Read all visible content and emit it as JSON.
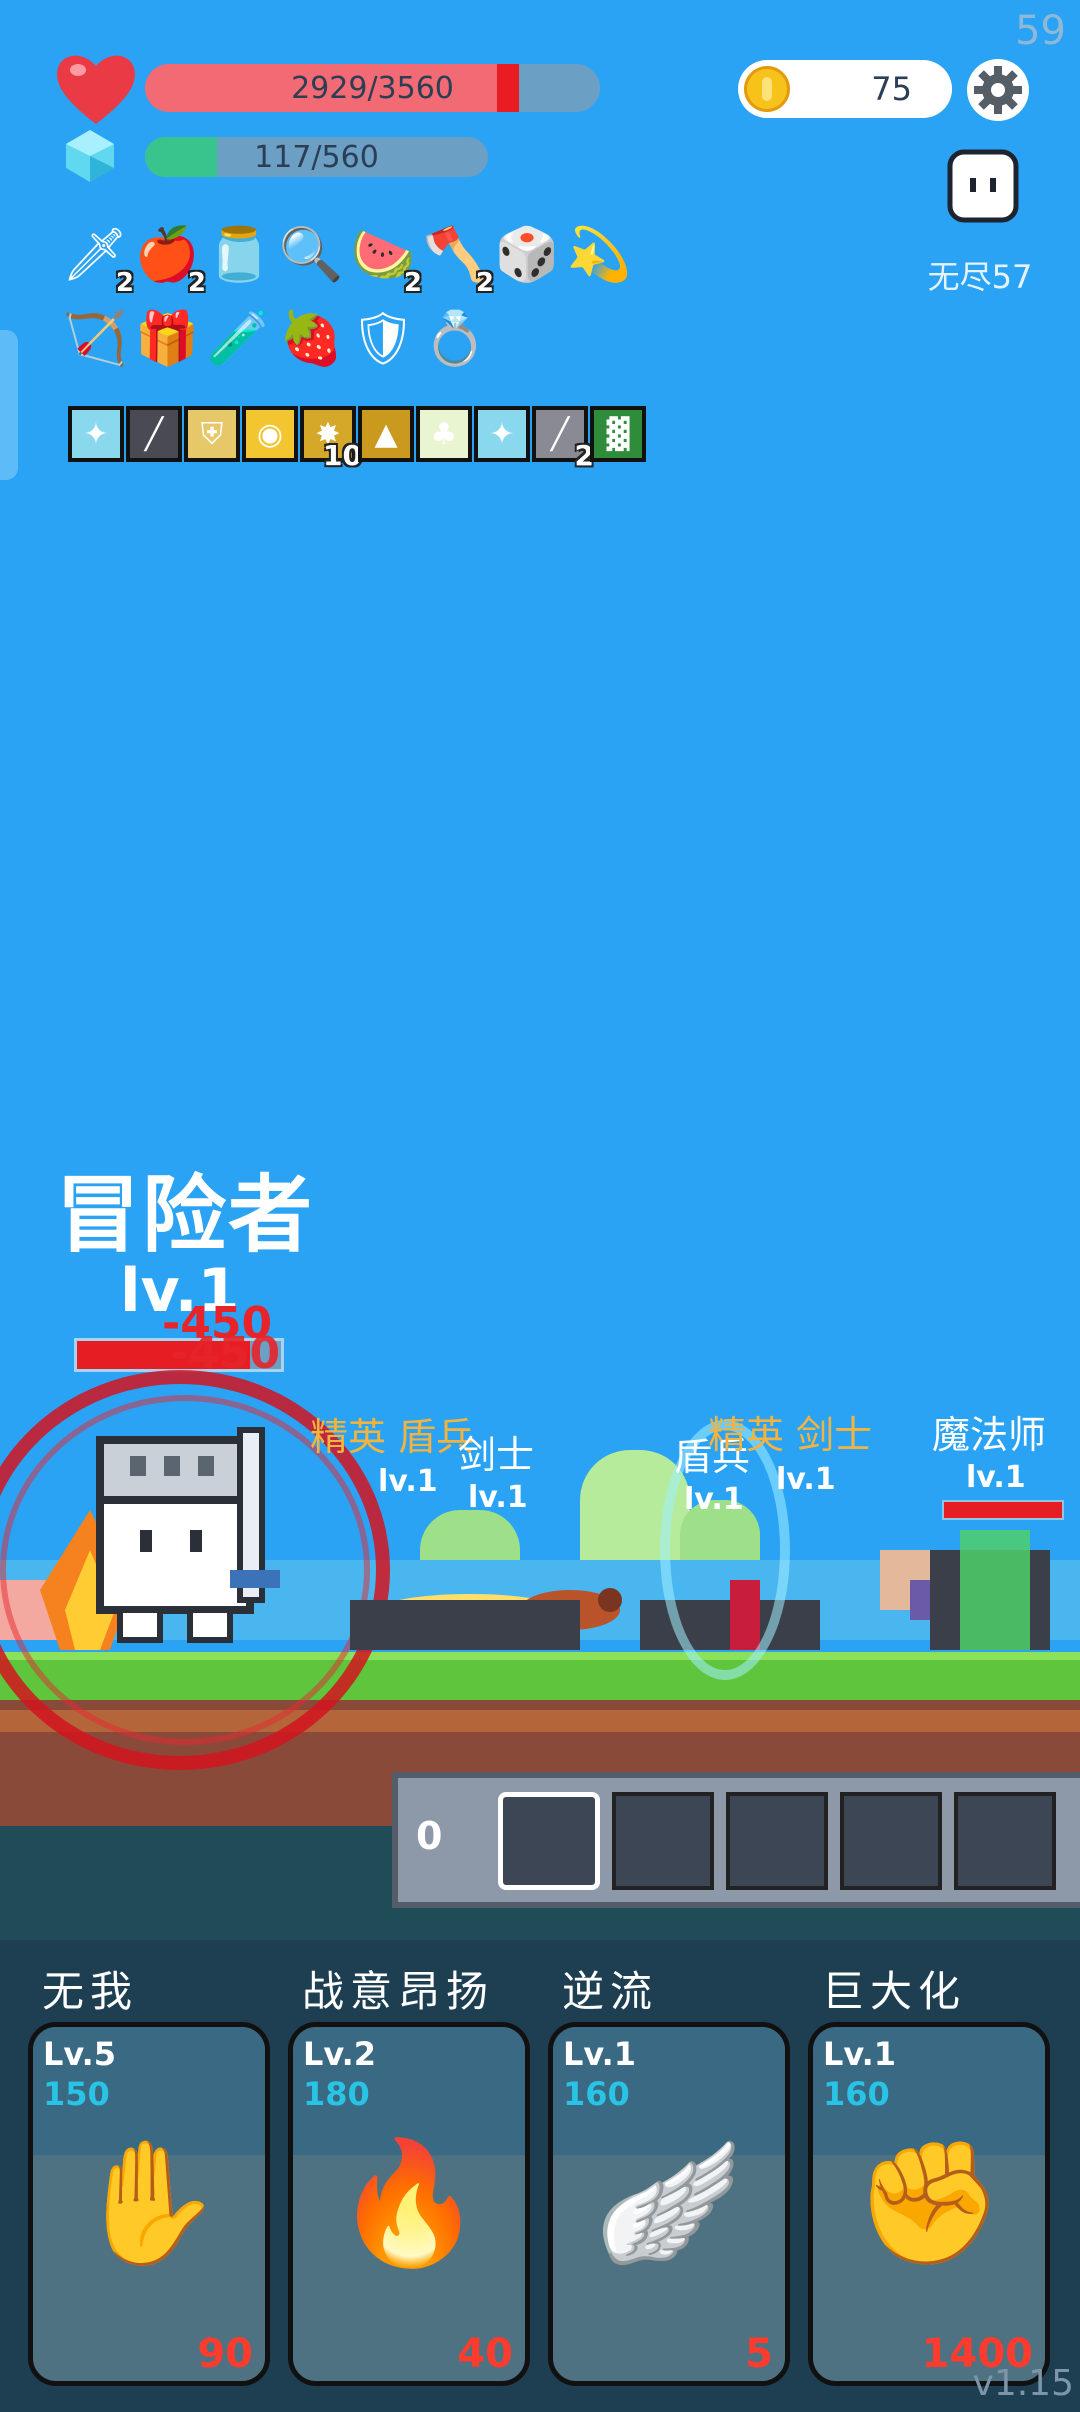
{
  "fps": "59",
  "hud": {
    "hp_text": "2929/3560",
    "hp_current": 2929,
    "hp_max": 3560,
    "mp_text": "117/560",
    "mp_current": 117,
    "mp_max": 560,
    "coins": "75",
    "mode_label": "无尽57",
    "colors": {
      "hp": "#f26a73",
      "hp_marker": "#ea1b23",
      "mp": "#39c48e",
      "coin": "#f7c21a"
    }
  },
  "items_row1": [
    {
      "icon": "sword-icon",
      "glyph": "🗡",
      "count": "2"
    },
    {
      "icon": "apple-icon",
      "glyph": "🍎",
      "count": "2"
    },
    {
      "icon": "jam-jar-icon",
      "glyph": "🫙",
      "count": ""
    },
    {
      "icon": "magnifier-icon",
      "glyph": "🔍",
      "count": ""
    },
    {
      "icon": "watermelon-icon",
      "glyph": "🍉",
      "count": "2"
    },
    {
      "icon": "axe-icon",
      "glyph": "🪓",
      "count": "2"
    },
    {
      "icon": "dice-icon",
      "glyph": "🎲",
      "count": ""
    },
    {
      "icon": "ring-orbit-icon",
      "glyph": "💫",
      "count": ""
    }
  ],
  "items_row2": [
    {
      "icon": "bow-icon",
      "glyph": "🏹",
      "count": ""
    },
    {
      "icon": "purple-chest-icon",
      "glyph": "🎁",
      "count": ""
    },
    {
      "icon": "potion-icon",
      "glyph": "🧪",
      "count": ""
    },
    {
      "icon": "strawberry-icon",
      "glyph": "🍓",
      "count": ""
    },
    {
      "icon": "shield-icon",
      "glyph": "🛡",
      "count": ""
    },
    {
      "icon": "ring-icon",
      "glyph": "💍",
      "count": ""
    }
  ],
  "relics": [
    {
      "icon": "light-relic-icon",
      "bg": "#8ad8ee",
      "glyph": "✦",
      "count": ""
    },
    {
      "icon": "blade-relic-icon",
      "bg": "#4a4a55",
      "glyph": "╱",
      "count": ""
    },
    {
      "icon": "shield-relic-icon",
      "bg": "#e6c86a",
      "glyph": "⛨",
      "count": ""
    },
    {
      "icon": "spiral-relic-icon",
      "bg": "#f2c531",
      "glyph": "◉",
      "count": ""
    },
    {
      "icon": "dark-relic-icon",
      "bg": "#d6a82a",
      "glyph": "✸",
      "count": "10"
    },
    {
      "icon": "shadow-relic-icon",
      "bg": "#c99a1e",
      "glyph": "▲",
      "count": ""
    },
    {
      "icon": "sprout-relic-icon",
      "bg": "#e9f4d0",
      "glyph": "♣",
      "count": ""
    },
    {
      "icon": "light-relic-icon",
      "bg": "#8ad8ee",
      "glyph": "✦",
      "count": ""
    },
    {
      "icon": "blade-relic-icon",
      "bg": "#8a8a95",
      "glyph": "╱",
      "count": "2"
    },
    {
      "icon": "moss-relic-icon",
      "bg": "#2e8c3a",
      "glyph": "▓",
      "count": ""
    }
  ],
  "hero": {
    "name": "冒险者",
    "level": "lv.1",
    "damage_numbers": [
      "-450",
      "-450"
    ],
    "hp_fraction": 0.85
  },
  "enemies": [
    {
      "label": "精英 盾兵",
      "level": "lv.1",
      "elite": true
    },
    {
      "label": "剑士",
      "level": "lv.1",
      "elite": false
    },
    {
      "label": "盾兵",
      "level": "lv.1",
      "elite": false
    },
    {
      "label": "精英 剑士",
      "level": "lv.1",
      "elite": true
    },
    {
      "label": "魔法师",
      "level": "lv.1",
      "elite": false
    }
  ],
  "queue": {
    "count": "0",
    "slots": 5,
    "selected": 0
  },
  "skills": [
    {
      "name": "无我",
      "level": "Lv.5",
      "cost": "150",
      "value": "90",
      "icon": "eye-hand-icon",
      "glyph": "✋"
    },
    {
      "name": "战意昂扬",
      "level": "Lv.2",
      "cost": "180",
      "value": "40",
      "icon": "flame-icon",
      "glyph": "🔥"
    },
    {
      "name": "逆流",
      "level": "Lv.1",
      "cost": "160",
      "value": "5",
      "icon": "wing-icon",
      "glyph": "🪽"
    },
    {
      "name": "巨大化",
      "level": "Lv.1",
      "cost": "160",
      "value": "1400",
      "icon": "fist-icon",
      "glyph": "✊"
    }
  ],
  "version": "v1.15"
}
